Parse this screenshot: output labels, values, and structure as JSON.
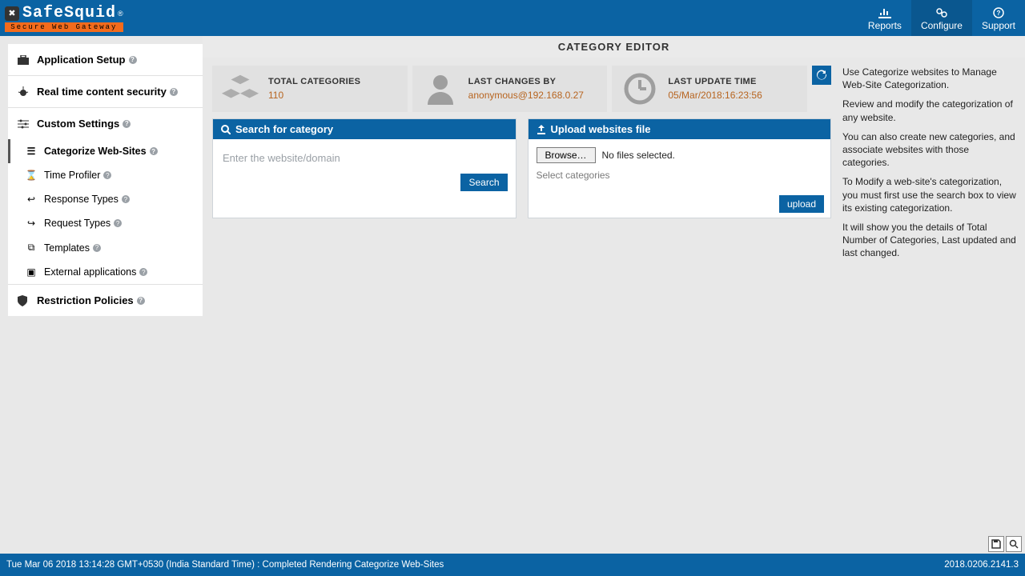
{
  "brand": {
    "name": "SafeSquid",
    "superscript": "®",
    "tagline": "Secure Web Gateway"
  },
  "topnav": {
    "reports": "Reports",
    "configure": "Configure",
    "support": "Support"
  },
  "sidebar": {
    "groups": [
      {
        "label": "Application Setup"
      },
      {
        "label": "Real time content security"
      },
      {
        "label": "Custom Settings",
        "items": [
          {
            "label": "Categorize Web-Sites",
            "active": true
          },
          {
            "label": "Time Profiler"
          },
          {
            "label": "Response Types"
          },
          {
            "label": "Request Types"
          },
          {
            "label": "Templates"
          },
          {
            "label": "External applications"
          }
        ]
      },
      {
        "label": "Restriction Policies"
      }
    ]
  },
  "page": {
    "title": "CATEGORY EDITOR"
  },
  "stats": {
    "totalCategories": {
      "label": "TOTAL CATEGORIES",
      "value": "110"
    },
    "lastChangesBy": {
      "label": "LAST CHANGES BY",
      "value": "anonymous@192.168.0.27"
    },
    "lastUpdateTime": {
      "label": "LAST UPDATE TIME",
      "value": "05/Mar/2018:16:23:56"
    }
  },
  "info": {
    "p1": "Use Categorize websites to Manage Web-Site Categorization.",
    "p2": "Review and modify the categorization of any website.",
    "p3": "You can also create new categories, and associate websites with those categories.",
    "p4": "To Modify a web-site's categorization, you must first use the search box to view its existing categorization.",
    "p5": "It will show you the details of Total Number of Categories, Last updated and last changed."
  },
  "panels": {
    "search": {
      "title": "Search for category",
      "placeholder": "Enter the website/domain",
      "button": "Search"
    },
    "upload": {
      "title": "Upload websites file",
      "browse": "Browse…",
      "status": "No files selected.",
      "select": "Select categories",
      "button": "upload"
    }
  },
  "footer": {
    "status": "Tue Mar 06 2018 13:14:28 GMT+0530 (India Standard Time) : Completed Rendering Categorize Web-Sites",
    "version": "2018.0206.2141.3"
  }
}
